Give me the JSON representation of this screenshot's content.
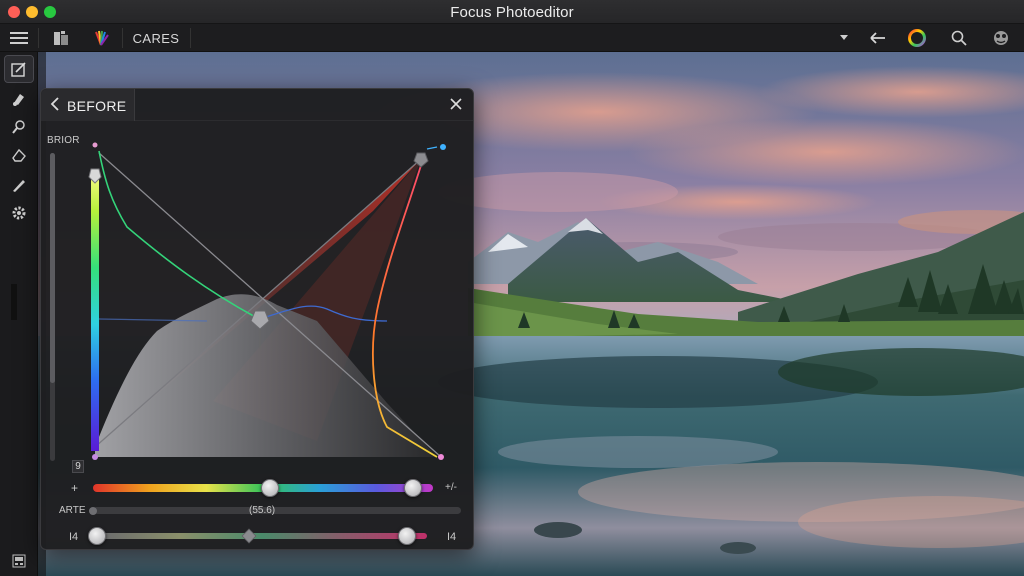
{
  "window": {
    "title": "Focus Photoeditor"
  },
  "toolbar": {
    "preset_label": "CARES"
  },
  "rail": {
    "items": [
      "crop-edit-icon",
      "brush-icon",
      "clone-icon",
      "eraser-icon",
      "pencil-icon",
      "settings-gear-icon"
    ]
  },
  "panel": {
    "title": "BEFORE",
    "graph_label": "BRIOR",
    "value_box": "9",
    "slider1": {
      "left_label": "+",
      "right_label": "+/-",
      "level": 0.52,
      "level2": 0.94
    },
    "slider2": {
      "label": "ARTE",
      "value": "(55.6)",
      "level": 0.0
    },
    "slider3": {
      "left_label": "I4",
      "right_label": "I4",
      "level_a": 0.0,
      "level_b": 0.46,
      "level_c": 0.94
    }
  },
  "colors": {
    "accent_green": "#35e07a",
    "accent_red": "#e0342a",
    "window_bg": "#1a1a1c"
  }
}
